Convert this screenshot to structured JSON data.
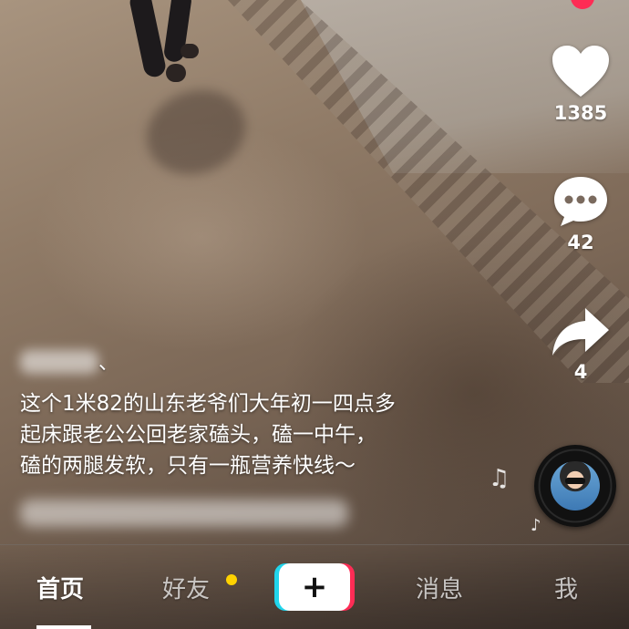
{
  "rail": {
    "like_count": "1385",
    "comment_count": "42",
    "share_count": "4"
  },
  "post": {
    "username_suffix": "、",
    "caption_lines": [
      "这个1米82的山东老爷们大年初一四点多",
      "起床跟老公公回老家磕头，磕一中午，",
      "磕的两腿发软，只有一瓶营养快线～"
    ]
  },
  "nav": {
    "home": "首页",
    "friends": "好友",
    "create": "+",
    "messages": "消息",
    "me": "我"
  },
  "colors": {
    "accent_red": "#fe2c55",
    "accent_cyan": "#20d5ec",
    "badge_yellow": "#ffd200"
  }
}
